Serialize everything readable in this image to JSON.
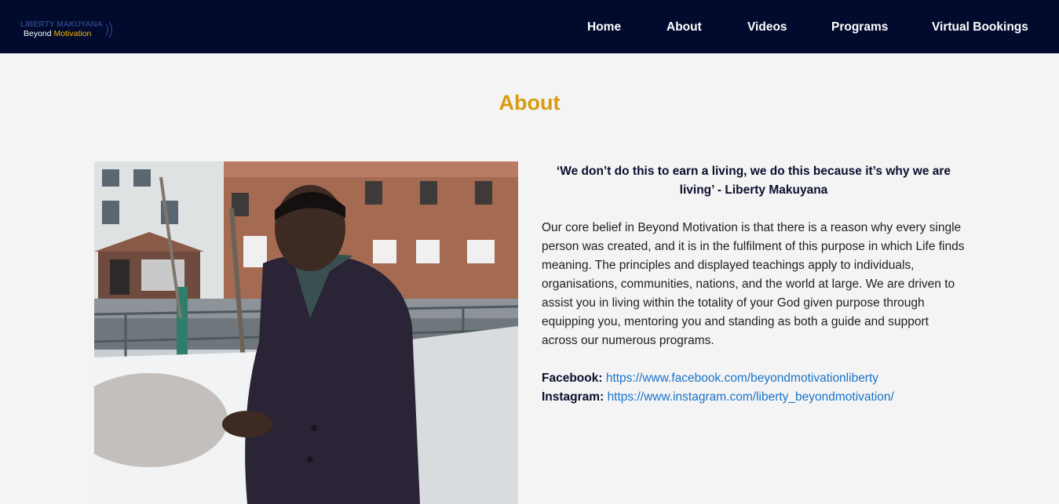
{
  "header": {
    "logo": {
      "line1": "LIBERTY MAKUYANA",
      "line2_part1": "Beyond",
      "line2_part2": "Motivation"
    },
    "nav": [
      "Home",
      "About",
      "Videos",
      "Programs",
      "Virtual Bookings"
    ]
  },
  "about": {
    "title": "About",
    "quote": "‘We don’t do this to earn a living, we do this because it’s why we are living’ - Liberty Makuyana",
    "body": "Our core belief in Beyond Motivation is that there is a reason why every single person was created, and it is in the fulfilment of this purpose in which Life finds meaning. The principles and displayed teachings apply to individuals, organisations, communities, nations, and the world at large. We are driven to assist you in living within the totality of your God given purpose through equipping you, mentoring you and standing as both a guide and support across our numerous programs.",
    "facebook_label": "Facebook:",
    "facebook_url": "https://www.facebook.com/beyondmotivationliberty",
    "instagram_label": "Instagram:",
    "instagram_url": "https://www.instagram.com/liberty_beyondmotivation/"
  },
  "colors": {
    "navbar": "#020b2e",
    "accent": "#d99a0f",
    "link": "#1a73c9",
    "background": "#f4f4f4"
  }
}
